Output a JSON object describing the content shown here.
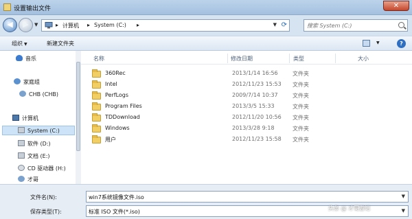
{
  "window": {
    "title": "设置输出文件"
  },
  "address": {
    "crumbs": [
      "计算机",
      "System (C:)"
    ],
    "search_placeholder": "搜索 System (C:)"
  },
  "toolbar": {
    "organize": "组织",
    "new_folder": "新建文件夹"
  },
  "nav": {
    "items": [
      {
        "label": "音乐",
        "icon": "music-icon"
      },
      {
        "label": "家庭组",
        "icon": "homegroup-icon"
      },
      {
        "label": "CHB (CHB)",
        "icon": "user-icon"
      },
      {
        "label": "计算机",
        "icon": "computer-icon"
      },
      {
        "label": "System (C:)",
        "icon": "drive-icon"
      },
      {
        "label": "软件 (D:)",
        "icon": "drive-icon"
      },
      {
        "label": "文档 (E:)",
        "icon": "drive-icon"
      },
      {
        "label": "CD 驱动器 (H:)",
        "icon": "cd-drive-icon"
      },
      {
        "label": "才哥",
        "icon": "user-icon"
      }
    ]
  },
  "files": {
    "columns": [
      "名称",
      "修改日期",
      "类型",
      "大小"
    ],
    "rows": [
      {
        "name": "360Rec",
        "date": "2013/1/14 16:56",
        "type": "文件夹"
      },
      {
        "name": "Intel",
        "date": "2012/11/23 15:53",
        "type": "文件夹"
      },
      {
        "name": "PerfLogs",
        "date": "2009/7/14 10:37",
        "type": "文件夹"
      },
      {
        "name": "Program Files",
        "date": "2013/3/5 15:33",
        "type": "文件夹"
      },
      {
        "name": "TDDownload",
        "date": "2012/11/20 10:56",
        "type": "文件夹"
      },
      {
        "name": "Windows",
        "date": "2013/3/28 9:18",
        "type": "文件夹"
      },
      {
        "name": "用户",
        "date": "2012/11/23 15:58",
        "type": "文件夹"
      }
    ]
  },
  "fields": {
    "filename_label": "文件名(N):",
    "filename_value": "win7系统镜像文件.iso",
    "filetype_label": "保存类型(T):",
    "filetype_value": "标准 ISO 文件(*.iso)"
  },
  "watermark": "头条 @ 才哥游记"
}
